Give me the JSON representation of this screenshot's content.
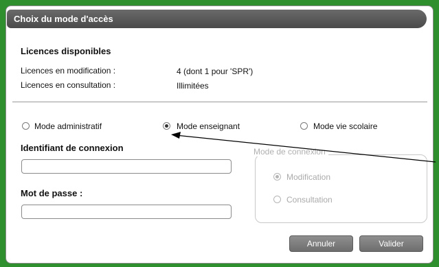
{
  "dialog": {
    "title": "Choix du mode d'accès"
  },
  "licences": {
    "heading": "Licences disponibles",
    "modification_label": "Licences en modification :",
    "modification_value": "4 (dont 1 pour 'SPR')",
    "consultation_label": "Licences en consultation :",
    "consultation_value": "Illimitées"
  },
  "modes": {
    "options": [
      {
        "label": "Mode administratif",
        "selected": false
      },
      {
        "label": "Mode enseignant",
        "selected": true
      },
      {
        "label": "Mode vie scolaire",
        "selected": false
      }
    ]
  },
  "login": {
    "id_label": "Identifiant de connexion",
    "id_value": "",
    "password_label": "Mot de passe :",
    "password_value": ""
  },
  "connexion": {
    "legend": "Mode de connexion",
    "options": [
      {
        "label": "Modification",
        "selected": true,
        "disabled": true
      },
      {
        "label": "Consultation",
        "selected": false,
        "disabled": true
      }
    ]
  },
  "buttons": {
    "cancel": "Annuler",
    "validate": "Valider"
  },
  "colors": {
    "frame": "#2f8f2f",
    "titlebar": "#555555",
    "button": "#7a7a7a"
  }
}
